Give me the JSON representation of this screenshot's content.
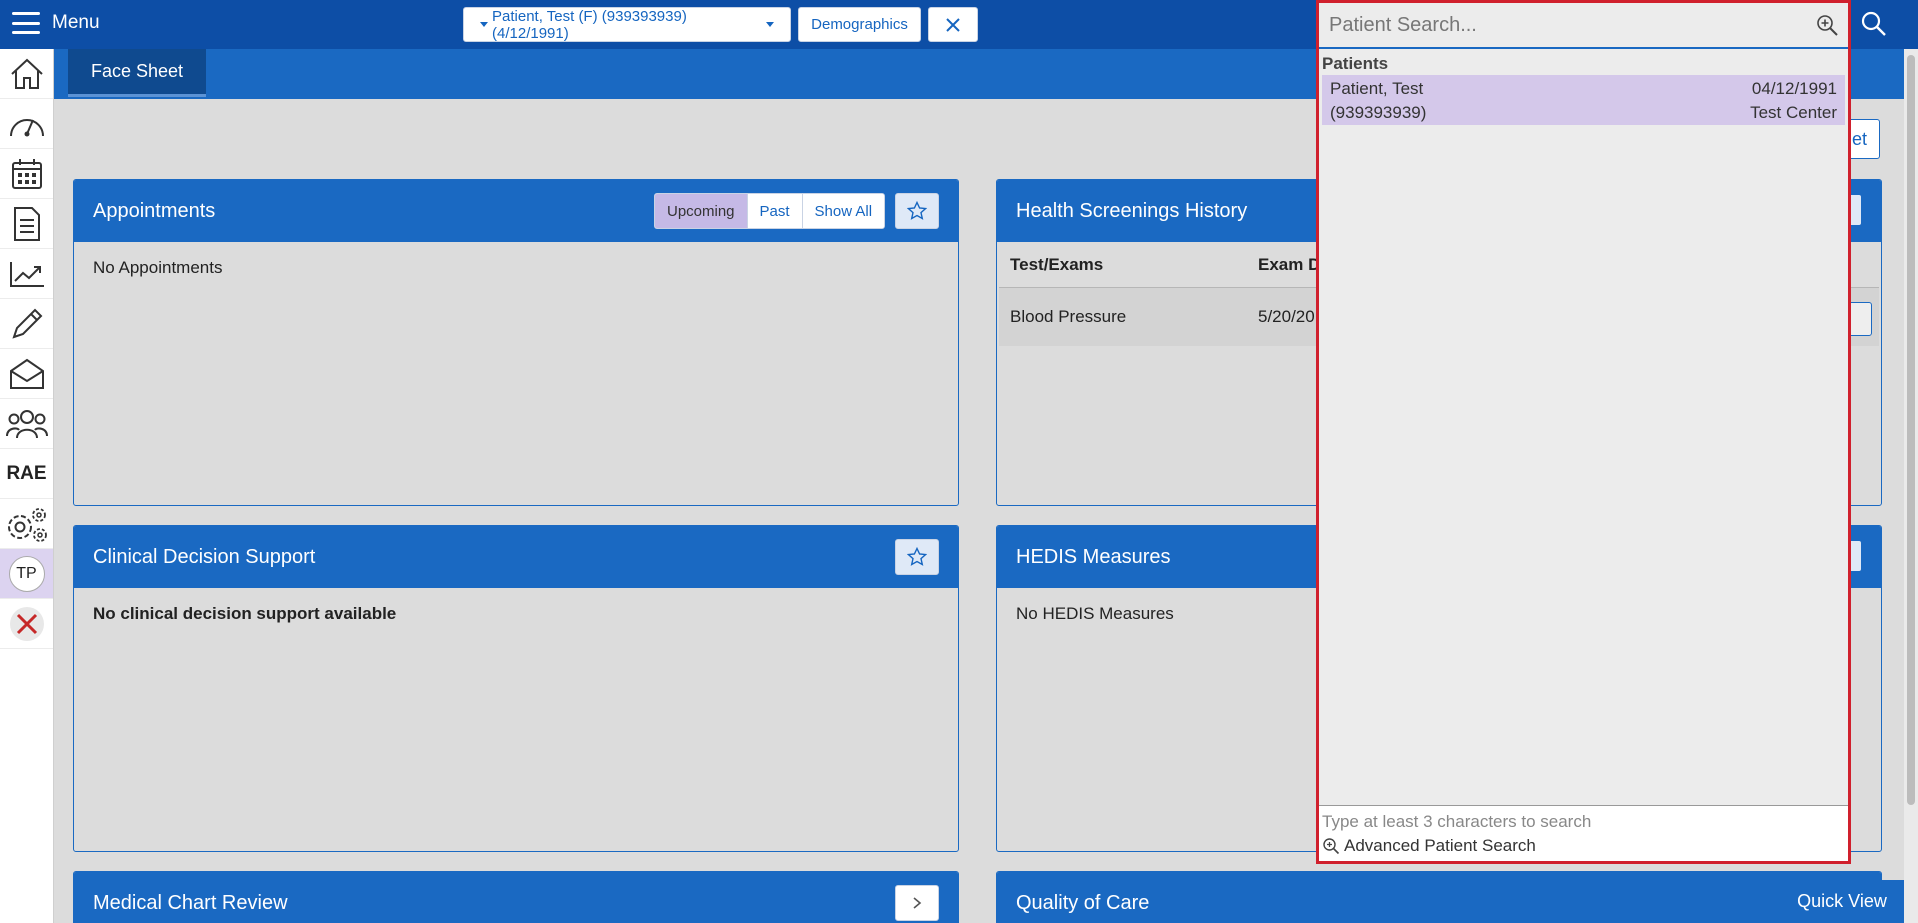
{
  "topbar": {
    "menu_label": "Menu",
    "patient_selector": "Patient, Test (F) (939393939) (4/12/1991)",
    "demographics_label": "Demographics"
  },
  "tabs": {
    "face_sheet": "Face Sheet"
  },
  "sidebar": {
    "items": [
      "home-icon",
      "dashboard-icon",
      "calendar-icon",
      "document-icon",
      "trend-chart-icon",
      "pencil-icon",
      "inbox-icon",
      "users-icon",
      "RAE",
      "settings-icon",
      "TP",
      "close-icon"
    ],
    "rae_label": "RAE",
    "avatar_initials": "TP"
  },
  "appointments": {
    "title": "Appointments",
    "filters": [
      "Upcoming",
      "Past",
      "Show All"
    ],
    "active_filter": "Upcoming",
    "empty_text": "No Appointments"
  },
  "health_screenings": {
    "title": "Health Screenings History",
    "columns": [
      "Test/Exams",
      "Exam D"
    ],
    "rows": [
      {
        "test": "Blood Pressure",
        "date": "5/20/20"
      }
    ]
  },
  "clinical_decision": {
    "title": "Clinical Decision Support",
    "empty_text": "No clinical decision support available"
  },
  "hedis": {
    "title": "HEDIS Measures",
    "empty_text": "No HEDIS Measures"
  },
  "medical_chart": {
    "title": "Medical Chart Review"
  },
  "quality_of_care": {
    "title": "Quality of Care"
  },
  "partial_button_text": "et",
  "quick_view": "Quick View",
  "patient_search": {
    "placeholder": "Patient Search...",
    "section_label": "Patients",
    "results": [
      {
        "name": "Patient, Test",
        "dob": "04/12/1991",
        "id": "(939393939)",
        "location": "Test Center"
      }
    ],
    "hint": "Type at least 3 characters to search",
    "advanced_label": "Advanced Patient Search"
  },
  "colors": {
    "header": "#0d4ea6",
    "panel_header": "#1a69c2",
    "highlight": "#d4c8ea",
    "dropdown_border": "#d0202d"
  }
}
